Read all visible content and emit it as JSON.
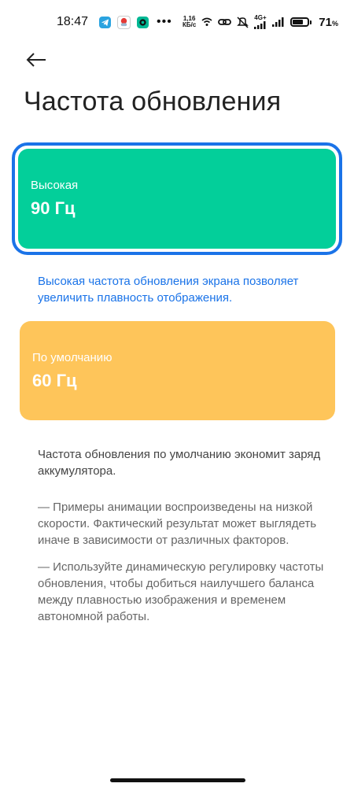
{
  "status_bar": {
    "time": "18:47",
    "more": "•••",
    "net_speed_value": "1,16",
    "net_speed_unit": "КБ/с",
    "network_type": "4G+",
    "battery_percent": "71",
    "battery_level": 0.71
  },
  "header": {
    "title": "Частота обновления"
  },
  "options": {
    "high": {
      "label": "Высокая",
      "value": "90 Гц",
      "color": "#03cf9a",
      "selected": true,
      "description": "Высокая частота обновления экрана позволяет увеличить плавность отображения."
    },
    "default": {
      "label": "По умолчанию",
      "value": "60 Гц",
      "color": "#fec55a",
      "selected": false,
      "description": "Частота обновления по умолчанию экономит заряд аккумулятора."
    }
  },
  "notes": [
    "— Примеры анимации воспроизведены на низкой скорости. Фактический результат может выглядеть иначе в зависимости от различных факторов.",
    "— Используйте динамическую регулировку частоты обновления, чтобы добиться наилучшего баланса между плавностью изображения и временем автономной работы."
  ],
  "colors": {
    "accent": "#1a73e8",
    "text_primary": "#222222",
    "text_secondary": "#666666"
  },
  "icons": {
    "back": "arrow-left-icon"
  }
}
